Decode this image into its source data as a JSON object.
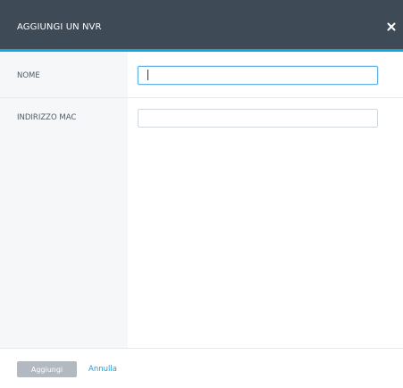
{
  "dialog": {
    "title": "AGGIUNGI UN NVR",
    "close_icon": "close-icon"
  },
  "form": {
    "name_label": "NOME",
    "name_value": "",
    "mac_label": "INDIRIZZO MAC",
    "mac_value": ""
  },
  "footer": {
    "add_label": "Aggiungi",
    "cancel_label": "Annulla"
  },
  "colors": {
    "header_bg": "#3e4a56",
    "accent": "#11a8e0",
    "disabled_button": "#b3b9c0",
    "link": "#1a9fd8"
  }
}
